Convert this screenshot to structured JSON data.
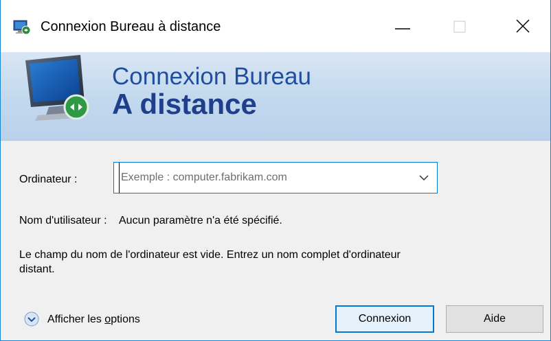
{
  "window": {
    "title": "Connexion Bureau à distance"
  },
  "banner": {
    "line1": "Connexion Bureau",
    "line2": "A distance"
  },
  "form": {
    "computer_label": "Ordinateur :",
    "computer_placeholder": "Exemple : computer.fabrikam.com",
    "computer_value": "",
    "user_label": "Nom d'utilisateur :",
    "user_value": "Aucun paramètre n'a été spécifié.",
    "info": "Le champ du nom de l'ordinateur est vide. Entrez un nom complet d'ordinateur distant."
  },
  "footer": {
    "options_label_prefix": "Afficher les ",
    "options_label_underlined": "o",
    "options_label_suffix": "ptions",
    "connect_label": "Connexion",
    "help_label": "Aide"
  },
  "icons": {
    "app": "remote-desktop-icon",
    "minimize": "minimize-icon",
    "maximize": "maximize-icon",
    "close": "close-icon",
    "dropdown": "chevron-down-icon",
    "options": "expand-circle-icon"
  },
  "colors": {
    "accent": "#0078d7",
    "banner_text": "#1f4e9c",
    "window_border": "#1883d7"
  }
}
